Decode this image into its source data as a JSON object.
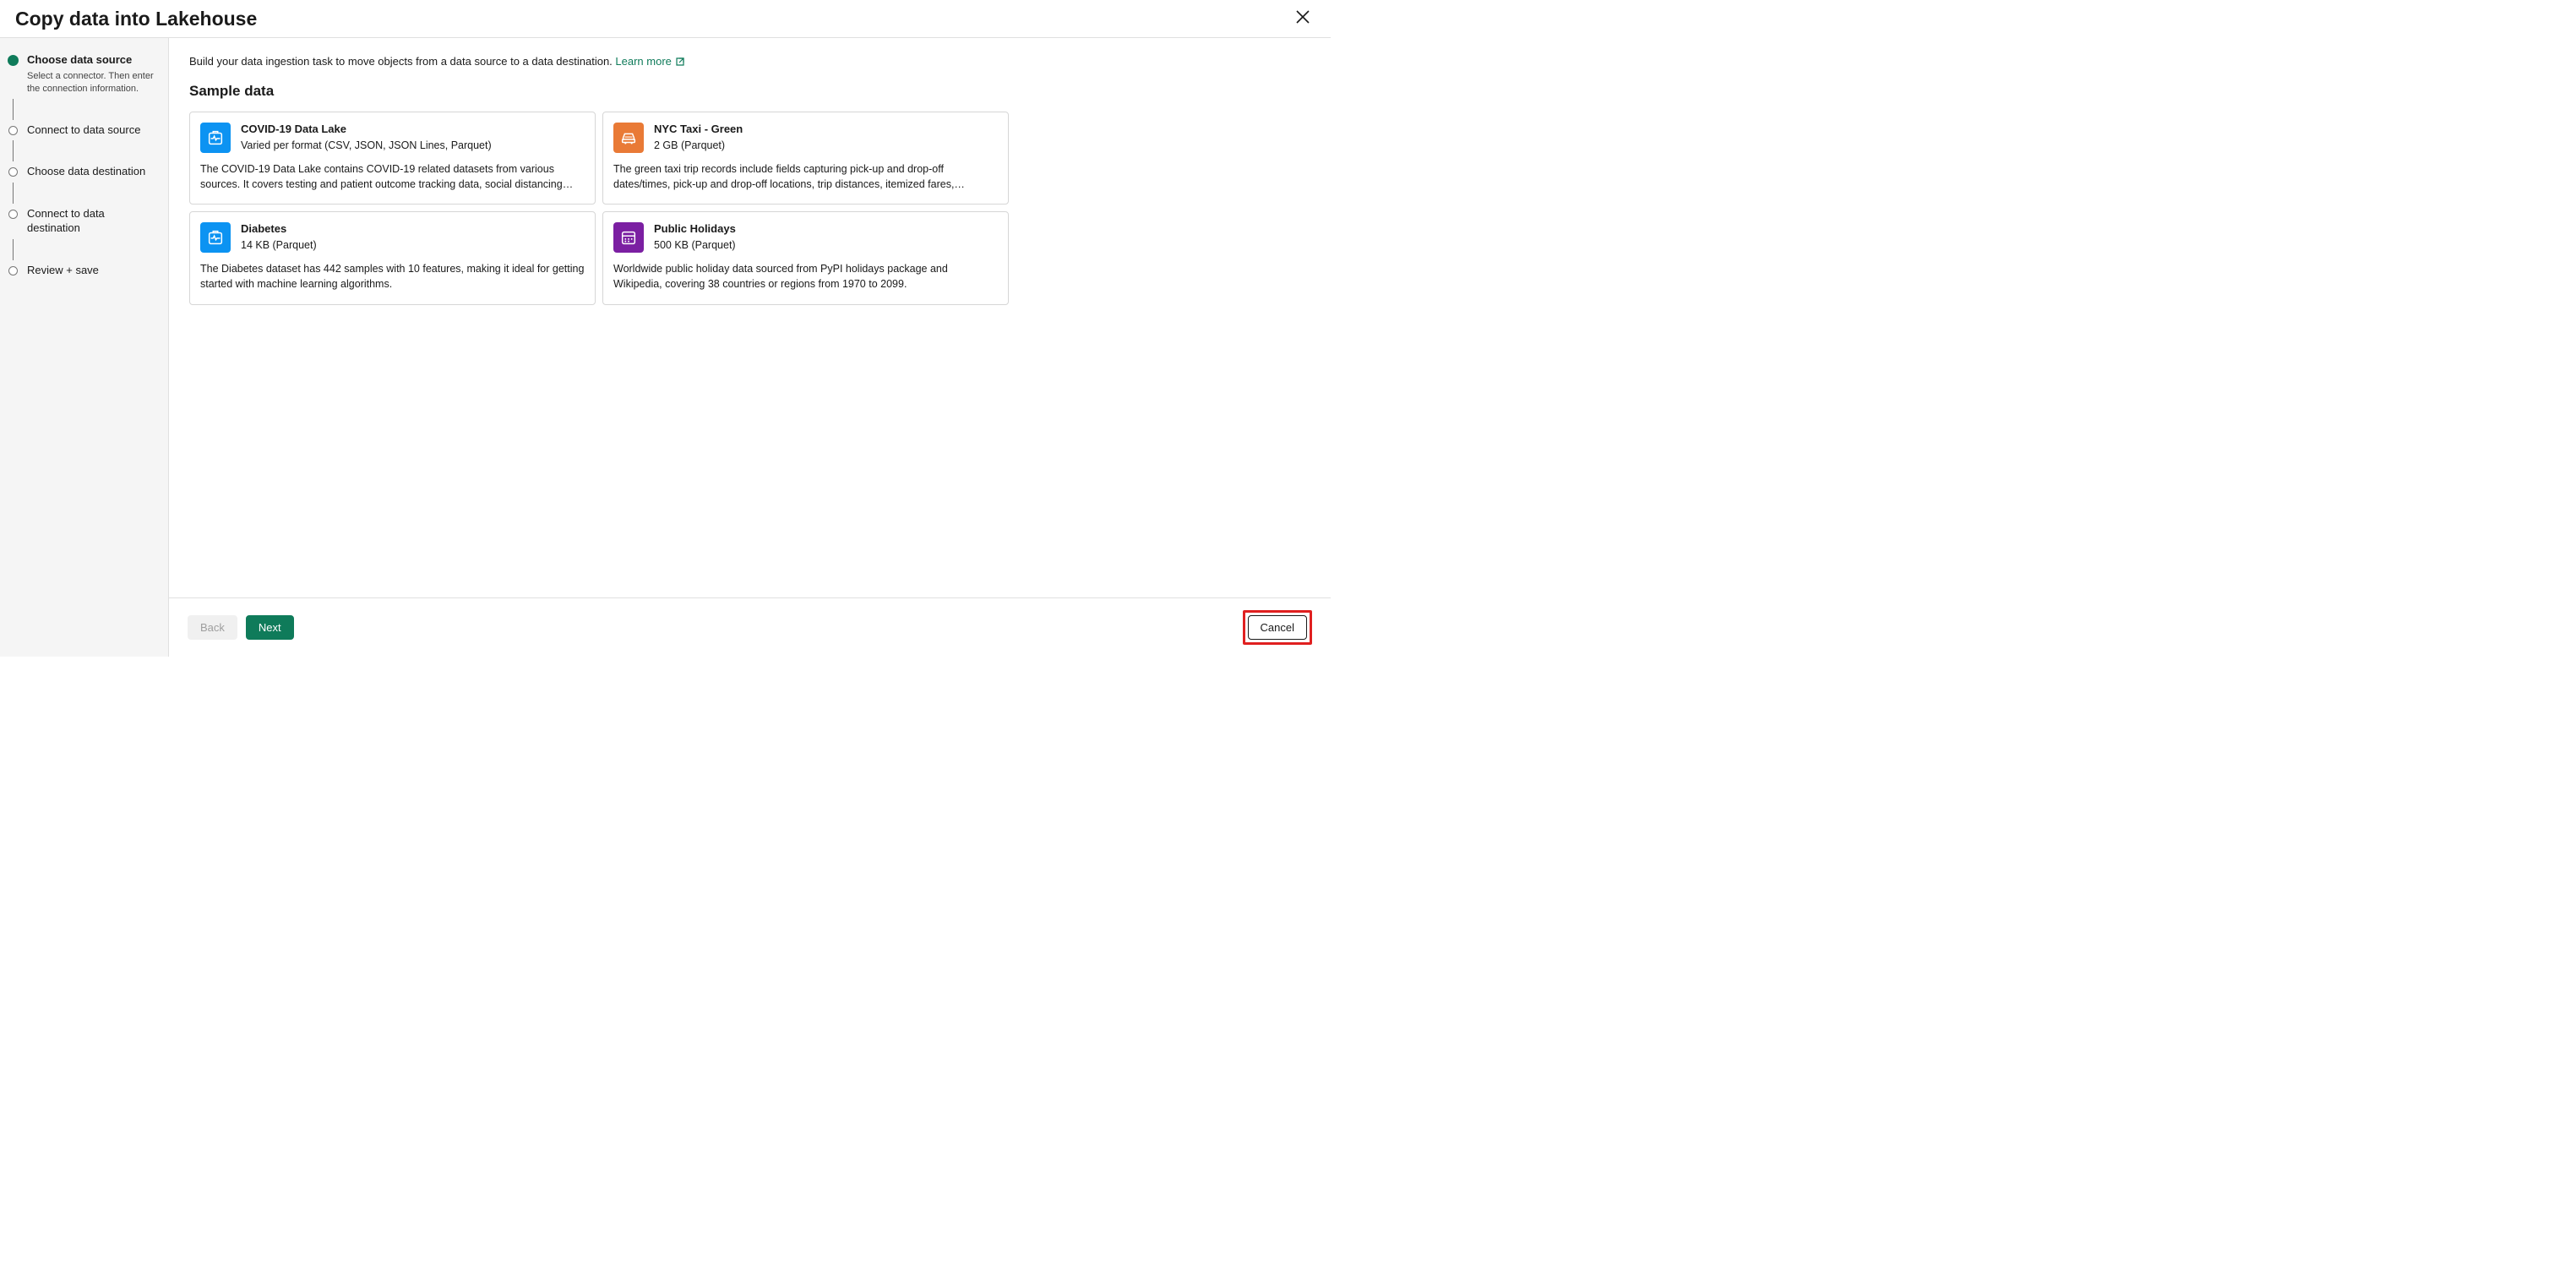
{
  "header": {
    "title": "Copy data into Lakehouse"
  },
  "steps": [
    {
      "title": "Choose data source",
      "desc": "Select a connector. Then enter the connection information.",
      "active": true
    },
    {
      "title": "Connect to data source"
    },
    {
      "title": "Choose data destination"
    },
    {
      "title": "Connect to data destination"
    },
    {
      "title": "Review + save"
    }
  ],
  "main": {
    "intro": "Build your data ingestion task to move objects from a data source to a data destination. ",
    "learn_more": "Learn more",
    "section_title": "Sample data"
  },
  "cards": [
    {
      "icon": "health-icon",
      "iconClass": "icon-blue",
      "title": "COVID-19 Data Lake",
      "subtitle": "Varied per format (CSV, JSON, JSON Lines, Parquet)",
      "desc": "The COVID-19 Data Lake contains COVID-19 related datasets from various sources. It covers testing and patient outcome tracking data, social distancing…"
    },
    {
      "icon": "taxi-icon",
      "iconClass": "icon-orange",
      "title": "NYC Taxi - Green",
      "subtitle": "2 GB (Parquet)",
      "desc": "The green taxi trip records include fields capturing pick-up and drop-off dates/times, pick-up and drop-off locations, trip distances, itemized fares,…"
    },
    {
      "icon": "health-icon",
      "iconClass": "icon-blue",
      "title": "Diabetes",
      "subtitle": "14 KB (Parquet)",
      "desc": "The Diabetes dataset has 442 samples with 10 features, making it ideal for getting started with machine learning algorithms."
    },
    {
      "icon": "calendar-icon",
      "iconClass": "icon-purple",
      "title": "Public Holidays",
      "subtitle": "500 KB (Parquet)",
      "desc": "Worldwide public holiday data sourced from PyPI holidays package and Wikipedia, covering 38 countries or regions from 1970 to 2099."
    }
  ],
  "footer": {
    "back": "Back",
    "next": "Next",
    "cancel": "Cancel"
  }
}
